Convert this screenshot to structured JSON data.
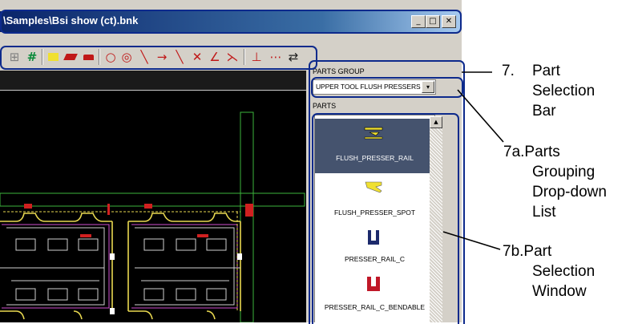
{
  "window": {
    "title": "\\Samples\\Bsi show (ct).bnk",
    "minimize_symbol": "_",
    "maximize_symbol": "□",
    "close_symbol": "✕"
  },
  "panel": {
    "parts_group_label": "PARTS GROUP",
    "parts_group_value": "UPPER TOOL FLUSH PRESSERS",
    "dropdown_arrow": "▾",
    "parts_label": "PARTS",
    "scroll_up_arrow": "▲",
    "parts": [
      {
        "name": "FLUSH_PRESSER_RAIL",
        "selected": true,
        "icon": "flush-presser-rail-icon"
      },
      {
        "name": "FLUSH_PRESSER_SPOT",
        "selected": false,
        "icon": "flush-presser-spot-icon"
      },
      {
        "name": "PRESSER_RAIL_C",
        "selected": false,
        "icon": "presser-rail-c-icon"
      },
      {
        "name": "PRESSER_RAIL_C_BENDABLE",
        "selected": false,
        "icon": "presser-rail-c-bendable-icon"
      }
    ]
  },
  "callouts": {
    "c7_num": "7.",
    "c7_l1": "Part",
    "c7_l2": "Selection",
    "c7_l3": "Bar",
    "c7a_l1": "7a.Parts",
    "c7a_l2": "Grouping",
    "c7a_l3": "Drop-down",
    "c7a_l4": "List",
    "c7b_l1": "7b.Part",
    "c7b_l2": "Selection",
    "c7b_l3": "Window"
  },
  "colors": {
    "title_bar": "#0a246a",
    "callout_border": "#0d2a8c",
    "selected_part": "#45536e",
    "canvas": "#000000"
  }
}
